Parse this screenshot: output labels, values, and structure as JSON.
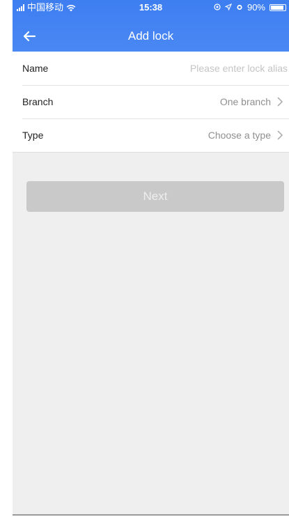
{
  "status_bar": {
    "carrier": "中国移动",
    "time": "15:38",
    "battery": "90%",
    "battery_level": 0.9,
    "icons": [
      "signal-icon",
      "wifi-icon",
      "location-icon",
      "alarm-icon",
      "battery-icon"
    ]
  },
  "nav": {
    "title": "Add lock",
    "back_icon": "arrow-left-icon"
  },
  "form": {
    "name": {
      "label": "Name",
      "placeholder": "Please enter lock alias",
      "value": ""
    },
    "branch": {
      "label": "Branch",
      "value": "One branch"
    },
    "type": {
      "label": "Type",
      "value": "Choose a type"
    }
  },
  "actions": {
    "next_label": "Next"
  },
  "colors": {
    "header": "#3d7ef1",
    "background": "#efefef",
    "button_disabled": "#c9c9c9"
  }
}
